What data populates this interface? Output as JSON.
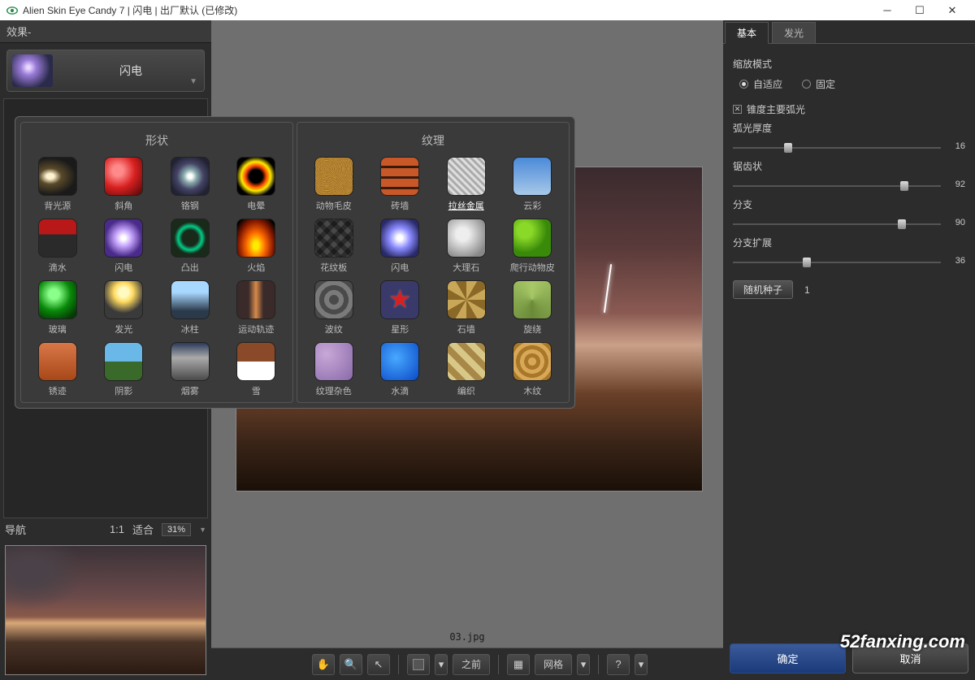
{
  "title": "Alien Skin Eye Candy 7 | 闪电 | 出厂默认  (已修改)",
  "left": {
    "header": "效果-",
    "current_effect": "闪电"
  },
  "nav": {
    "label": "导航",
    "ratio": "1:1",
    "fit": "适合",
    "zoom": "31%"
  },
  "popup": {
    "shape_title": "形状",
    "texture_title": "纹理",
    "shapes": [
      {
        "k": "backlight",
        "l": "背光源"
      },
      {
        "k": "bevel",
        "l": "斜角"
      },
      {
        "k": "chrome",
        "l": "铬钢"
      },
      {
        "k": "corona",
        "l": "电晕"
      },
      {
        "k": "drip",
        "l": "滴水"
      },
      {
        "k": "lightning",
        "l": "闪电"
      },
      {
        "k": "extrude",
        "l": "凸出"
      },
      {
        "k": "fire",
        "l": "火焰"
      },
      {
        "k": "glass",
        "l": "玻璃"
      },
      {
        "k": "glow",
        "l": "发光"
      },
      {
        "k": "icicle",
        "l": "冰柱"
      },
      {
        "k": "motion",
        "l": "运动轨迹"
      },
      {
        "k": "rust",
        "l": "锈迹"
      },
      {
        "k": "shadow",
        "l": "阴影"
      },
      {
        "k": "smoke",
        "l": "烟雾"
      },
      {
        "k": "snow",
        "l": "雪"
      }
    ],
    "textures": [
      {
        "k": "fur",
        "l": "动物毛皮"
      },
      {
        "k": "brick",
        "l": "砖墙"
      },
      {
        "k": "metal",
        "l": "拉丝金属"
      },
      {
        "k": "cloud",
        "l": "云彩"
      },
      {
        "k": "diamond",
        "l": "花纹板"
      },
      {
        "k": "tlightning",
        "l": "闪电"
      },
      {
        "k": "marble",
        "l": "大理石"
      },
      {
        "k": "reptile",
        "l": "爬行动物皮"
      },
      {
        "k": "ripple",
        "l": "波纹"
      },
      {
        "k": "star",
        "l": "星形"
      },
      {
        "k": "stone",
        "l": "石墙"
      },
      {
        "k": "swirl",
        "l": "旋绕"
      },
      {
        "k": "noise",
        "l": "纹理杂色"
      },
      {
        "k": "water",
        "l": "水滴"
      },
      {
        "k": "weave",
        "l": "编织"
      },
      {
        "k": "wood",
        "l": "木纹"
      }
    ]
  },
  "right": {
    "tab_basic": "基本",
    "tab_glow": "发光",
    "scale_mode": "缩放模式",
    "radio_fit": "自适应",
    "radio_fixed": "固定",
    "chk_main": "锥度主要弧光",
    "s1_label": "弧光厚度",
    "s1_val": "16",
    "s2_label": "锯齿状",
    "s2_val": "92",
    "s3_label": "分支",
    "s3_val": "90",
    "s4_label": "分支扩展",
    "s4_val": "36",
    "seed_btn": "随机种子",
    "seed_val": "1",
    "ok": "确定",
    "cancel": "取消"
  },
  "toolbar": {
    "before": "之前",
    "grid": "网格"
  },
  "filename": "03.jpg",
  "watermark": "52fanxing.com"
}
